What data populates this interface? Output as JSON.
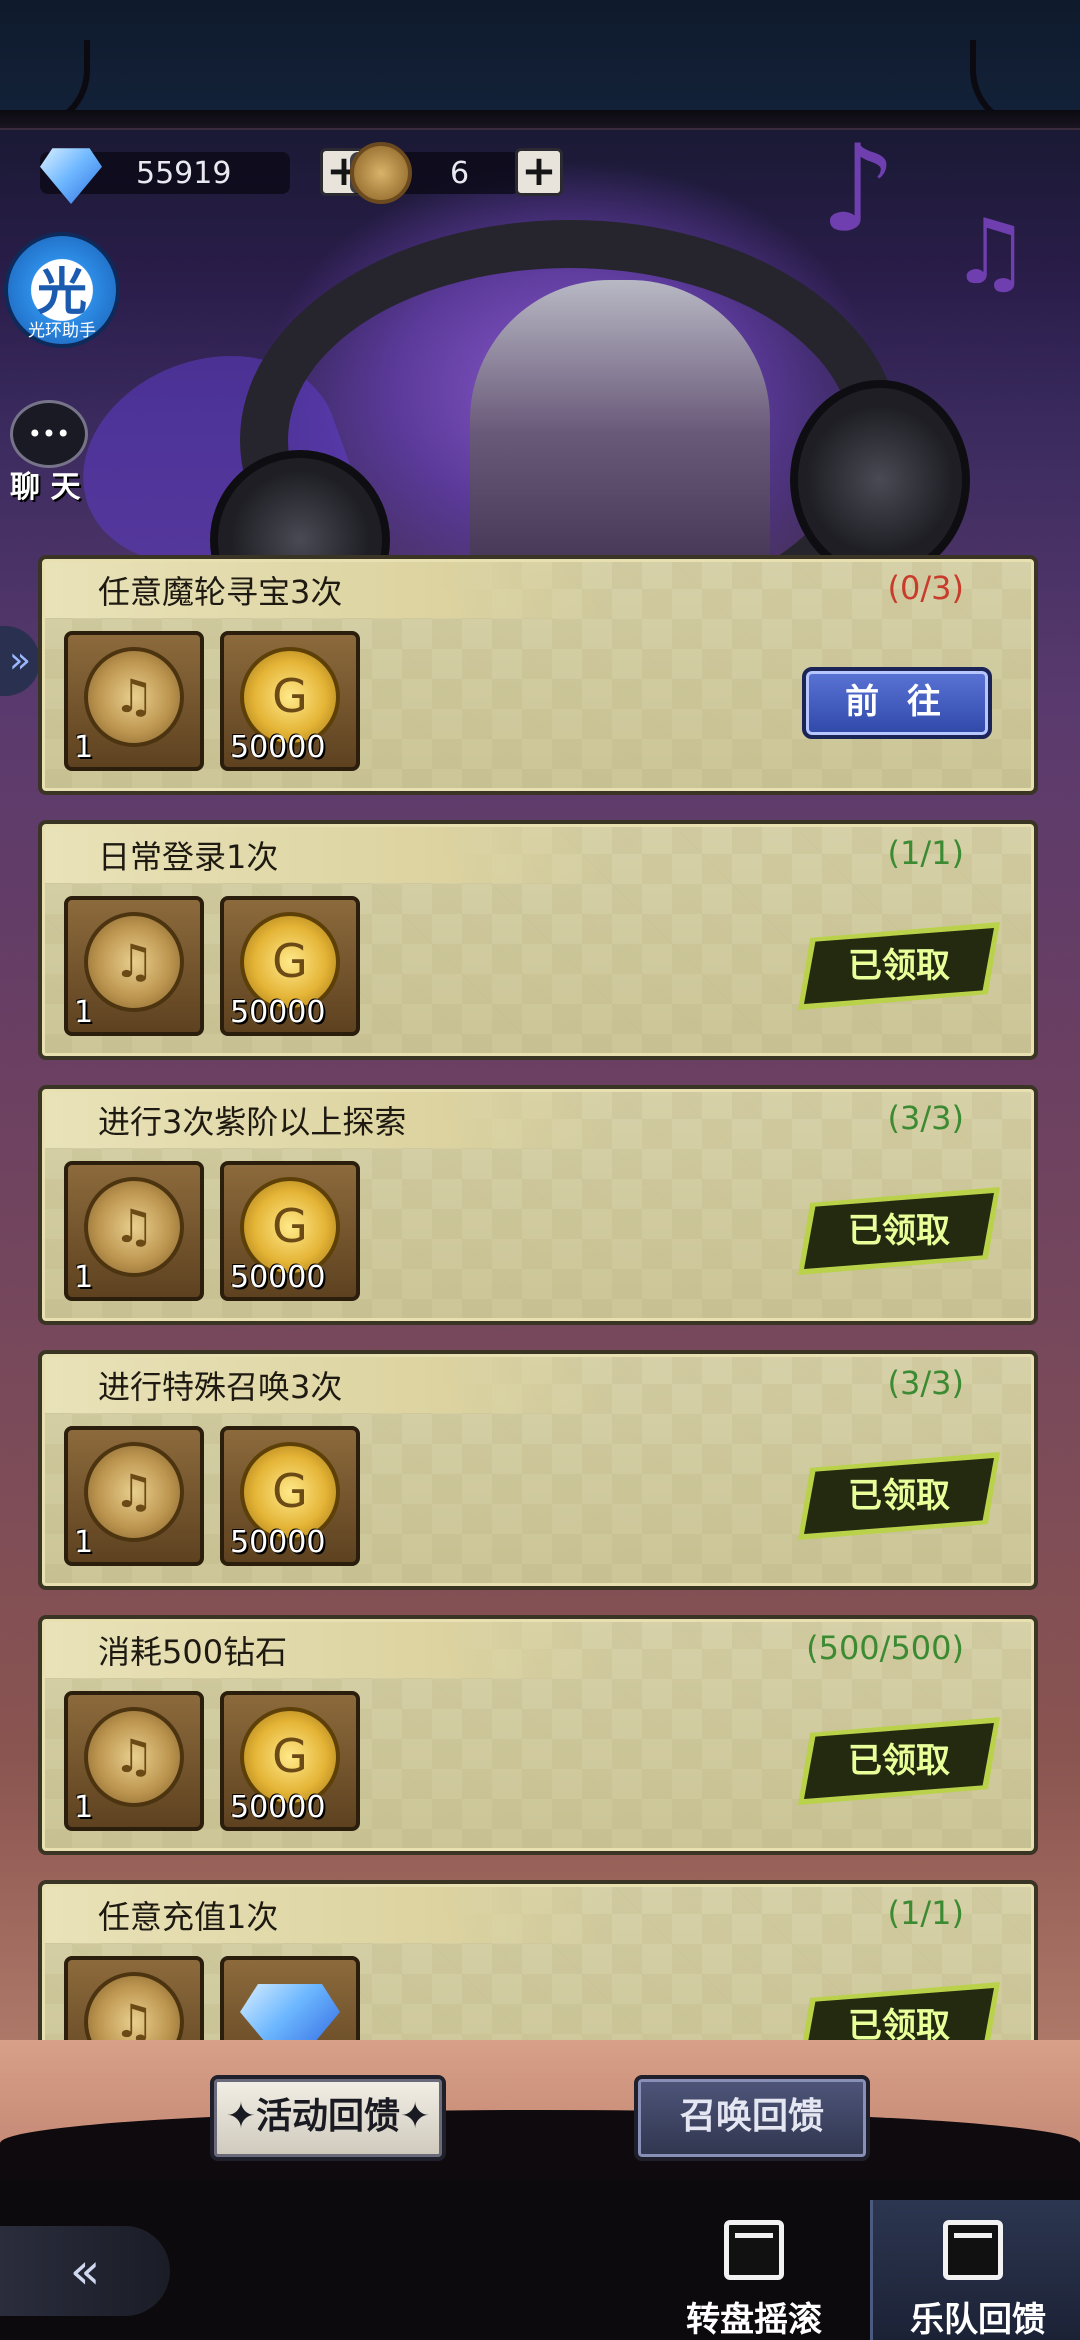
{
  "resources": {
    "diamond": {
      "icon": "diamond-icon",
      "value": "55919"
    },
    "guitar_coin": {
      "icon": "guitar-coin-icon",
      "value": "6"
    },
    "plus_label": "+"
  },
  "side": {
    "assistant": {
      "glyph": "光",
      "label": "光环助手"
    },
    "chat": {
      "label": "聊 天",
      "icon": "chat-bubble-icon"
    },
    "expand_glyph": "»"
  },
  "tasks": [
    {
      "title": "任意魔轮寻宝3次",
      "progress": "(0/3)",
      "status": "todo",
      "action": "前 往",
      "rewards": [
        {
          "icon": "guitar-coin-icon",
          "qty": "1"
        },
        {
          "icon": "gold-coin-icon",
          "qty": "50000"
        }
      ]
    },
    {
      "title": "日常登录1次",
      "progress": "(1/1)",
      "status": "done",
      "action": "已领取",
      "rewards": [
        {
          "icon": "guitar-coin-icon",
          "qty": "1"
        },
        {
          "icon": "gold-coin-icon",
          "qty": "50000"
        }
      ]
    },
    {
      "title": "进行3次紫阶以上探索",
      "progress": "(3/3)",
      "status": "done",
      "action": "已领取",
      "rewards": [
        {
          "icon": "guitar-coin-icon",
          "qty": "1"
        },
        {
          "icon": "gold-coin-icon",
          "qty": "50000"
        }
      ]
    },
    {
      "title": "进行特殊召唤3次",
      "progress": "(3/3)",
      "status": "done",
      "action": "已领取",
      "rewards": [
        {
          "icon": "guitar-coin-icon",
          "qty": "1"
        },
        {
          "icon": "gold-coin-icon",
          "qty": "50000"
        }
      ]
    },
    {
      "title": "消耗500钻石",
      "progress": "(500/500)",
      "status": "done",
      "action": "已领取",
      "rewards": [
        {
          "icon": "guitar-coin-icon",
          "qty": "1"
        },
        {
          "icon": "gold-coin-icon",
          "qty": "50000"
        }
      ]
    },
    {
      "title": "任意充值1次",
      "progress": "(1/1)",
      "status": "done",
      "action": "已领取",
      "rewards": [
        {
          "icon": "guitar-coin-icon",
          "qty": ""
        },
        {
          "icon": "diamond-icon",
          "qty": ""
        }
      ]
    }
  ],
  "sub_tabs": {
    "active": "✦活动回馈✦",
    "inactive": "召唤回馈"
  },
  "bottom_nav": {
    "back_icon": "back-arrow-icon",
    "tabs": [
      {
        "label": "转盘摇滚",
        "icon": "calendar-icon",
        "active": false
      },
      {
        "label": "乐队回馈",
        "icon": "calendar-icon",
        "active": true
      }
    ]
  },
  "colors": {
    "progress_done": "#3c8a32",
    "progress_todo": "#c83c2c",
    "go_button": "#3b56b8",
    "claimed_text": "#e8ff9a"
  }
}
